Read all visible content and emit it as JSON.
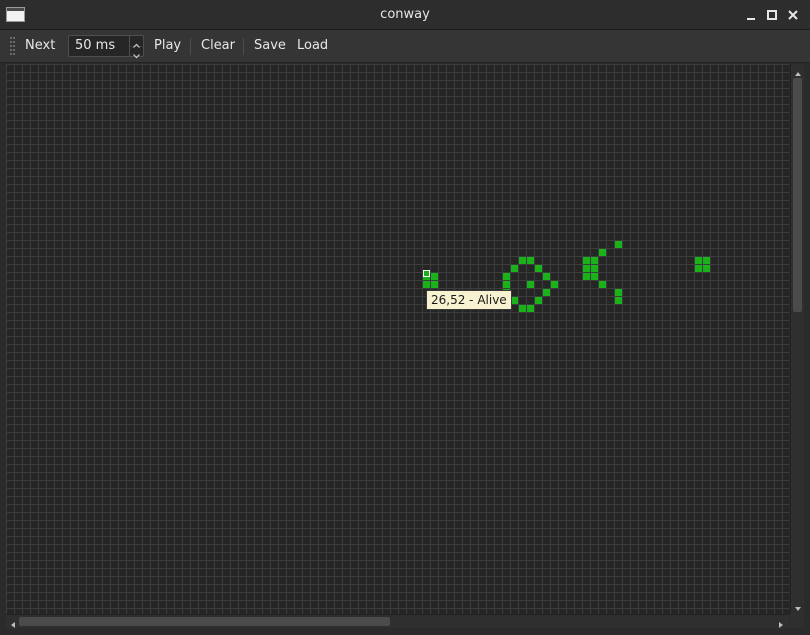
{
  "window": {
    "title": "conway"
  },
  "toolbar": {
    "next_label": "Next",
    "interval_value": "50 ms",
    "play_label": "Play",
    "clear_label": "Clear",
    "save_label": "Save",
    "load_label": "Load"
  },
  "board": {
    "cell_color": "#19b219",
    "live_cells": [
      [
        52,
        26
      ],
      [
        53,
        26
      ],
      [
        52,
        27
      ],
      [
        53,
        27
      ],
      [
        64,
        24
      ],
      [
        65,
        24
      ],
      [
        63,
        25
      ],
      [
        66,
        25
      ],
      [
        62,
        26
      ],
      [
        67,
        26
      ],
      [
        62,
        27
      ],
      [
        65,
        27
      ],
      [
        68,
        27
      ],
      [
        62,
        28
      ],
      [
        67,
        28
      ],
      [
        63,
        29
      ],
      [
        66,
        29
      ],
      [
        64,
        30
      ],
      [
        65,
        30
      ],
      [
        72,
        24
      ],
      [
        73,
        24
      ],
      [
        72,
        25
      ],
      [
        73,
        25
      ],
      [
        72,
        26
      ],
      [
        73,
        26
      ],
      [
        74,
        23
      ],
      [
        74,
        27
      ],
      [
        76,
        22
      ],
      [
        76,
        28
      ],
      [
        76,
        29
      ],
      [
        86,
        24
      ],
      [
        87,
        24
      ],
      [
        86,
        25
      ],
      [
        87,
        25
      ]
    ],
    "hovered_cell": [
      52,
      26
    ],
    "tooltip": "26,52 - Alive"
  },
  "icons": {
    "minimize": "minimize-icon",
    "maximize": "maximize-icon",
    "close": "close-icon",
    "spin_up": "chevron-up-icon",
    "spin_down": "chevron-down-icon"
  }
}
